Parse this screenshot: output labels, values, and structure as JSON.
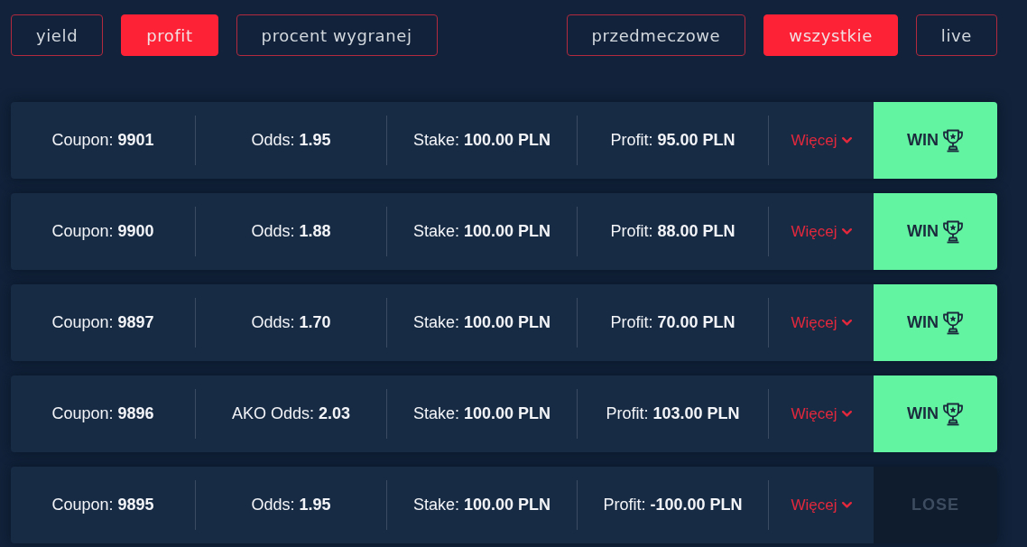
{
  "metric_tabs": [
    {
      "label": "yield",
      "selected": false
    },
    {
      "label": "profit",
      "selected": true
    },
    {
      "label": "procent wygranej",
      "selected": false
    }
  ],
  "type_tabs": [
    {
      "label": "przedmeczowe",
      "selected": false
    },
    {
      "label": "wszystkie",
      "selected": true
    },
    {
      "label": "live",
      "selected": false
    }
  ],
  "coupons": [
    {
      "fields": [
        {
          "label": "Coupon:",
          "value": "9901"
        },
        {
          "label": "Odds:",
          "value": "1.95"
        },
        {
          "label": "Stake:",
          "value": "100.00 PLN"
        },
        {
          "label": "Profit:",
          "value": "95.00 PLN"
        }
      ],
      "more": "Więcej",
      "result": {
        "kind": "win",
        "label": "WIN"
      }
    },
    {
      "fields": [
        {
          "label": "Coupon:",
          "value": "9900"
        },
        {
          "label": "Odds:",
          "value": "1.88"
        },
        {
          "label": "Stake:",
          "value": "100.00 PLN"
        },
        {
          "label": "Profit:",
          "value": "88.00 PLN"
        }
      ],
      "more": "Więcej",
      "result": {
        "kind": "win",
        "label": "WIN"
      }
    },
    {
      "fields": [
        {
          "label": "Coupon:",
          "value": "9897"
        },
        {
          "label": "Odds:",
          "value": "1.70"
        },
        {
          "label": "Stake:",
          "value": "100.00 PLN"
        },
        {
          "label": "Profit:",
          "value": "70.00 PLN"
        }
      ],
      "more": "Więcej",
      "result": {
        "kind": "win",
        "label": "WIN"
      }
    },
    {
      "fields": [
        {
          "label": "Coupon:",
          "value": "9896"
        },
        {
          "label": "AKO Odds:",
          "value": "2.03"
        },
        {
          "label": "Stake:",
          "value": "100.00 PLN"
        },
        {
          "label": "Profit:",
          "value": "103.00 PLN"
        }
      ],
      "more": "Więcej",
      "result": {
        "kind": "win",
        "label": "WIN"
      }
    },
    {
      "fields": [
        {
          "label": "Coupon:",
          "value": "9895"
        },
        {
          "label": "Odds:",
          "value": "1.95"
        },
        {
          "label": "Stake:",
          "value": "100.00 PLN"
        },
        {
          "label": "Profit:",
          "value": "-100.00 PLN"
        }
      ],
      "more": "Więcej",
      "result": {
        "kind": "lose",
        "label": "LOSE"
      }
    }
  ]
}
